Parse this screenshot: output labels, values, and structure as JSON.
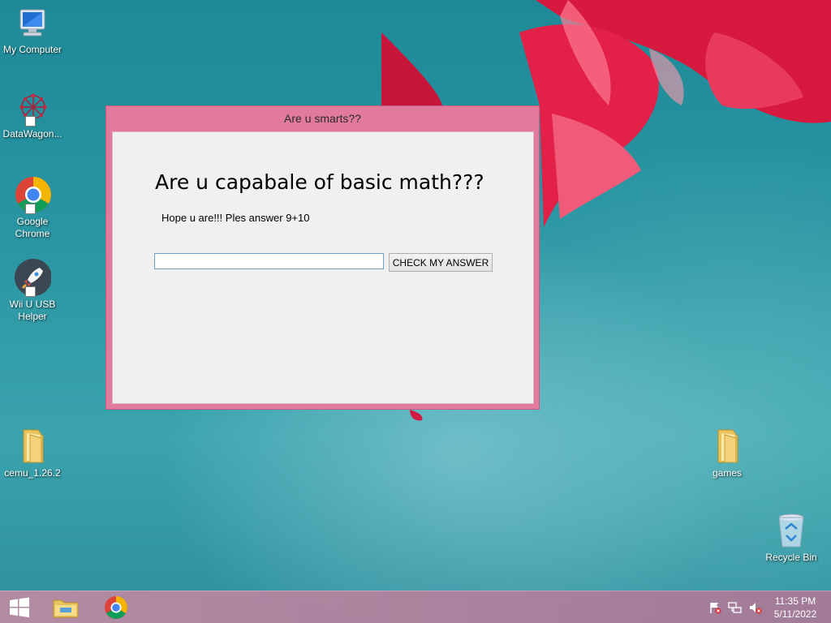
{
  "desktop": {
    "icons": [
      {
        "label": "My Computer",
        "icon": "computer-icon"
      },
      {
        "label": "DataWagon...",
        "icon": "datawagon-icon"
      },
      {
        "label": "Google Chrome",
        "icon": "chrome-icon"
      },
      {
        "label": "Wii U USB Helper",
        "icon": "rocket-icon"
      },
      {
        "label": "cemu_1.26.2",
        "icon": "folder-icon"
      },
      {
        "label": "games",
        "icon": "folder-icon"
      },
      {
        "label": "Recycle Bin",
        "icon": "recycle-bin-icon"
      }
    ]
  },
  "window": {
    "title": "Are u smarts??",
    "heading": "Are u capabale of basic math???",
    "subtext": "Hope u are!!! Ples answer 9+10",
    "input_value": "",
    "button_label": "CHECK MY ANSWER"
  },
  "taskbar": {
    "buttons": [
      {
        "icon": "windows-start-icon"
      },
      {
        "icon": "file-explorer-icon"
      },
      {
        "icon": "chrome-icon"
      }
    ],
    "tray": [
      {
        "icon": "action-center-flag-icon"
      },
      {
        "icon": "network-icon"
      },
      {
        "icon": "volume-muted-icon"
      }
    ],
    "time": "11:35 PM",
    "date": "5/11/2022"
  },
  "colors": {
    "window_frame": "#e27a9c",
    "taskbar": "#b98aa5",
    "wallpaper": "#2b96a3"
  }
}
